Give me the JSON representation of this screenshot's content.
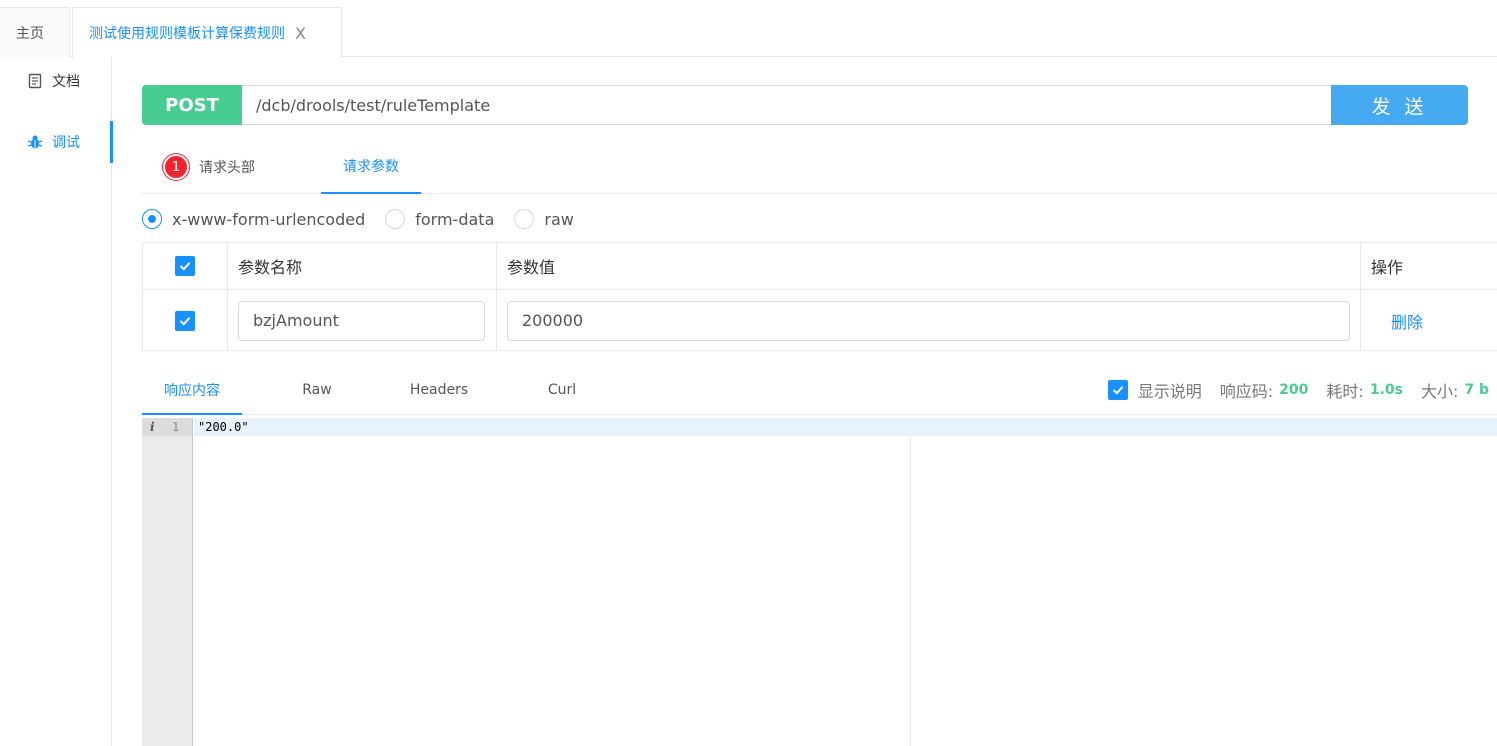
{
  "tabs": {
    "home": "主页",
    "active": "测试使用规则模板计算保费规则",
    "close": "X"
  },
  "sidenav": {
    "doc": "文档",
    "debug": "调试"
  },
  "request": {
    "method": "POST",
    "url": "/dcb/drools/test/ruleTemplate",
    "send": "发 送"
  },
  "reqtabs": {
    "headers_badge": "1",
    "headers": "请求头部",
    "params": "请求参数"
  },
  "body_types": {
    "options": [
      "x-www-form-urlencoded",
      "form-data",
      "raw"
    ],
    "selected": "x-www-form-urlencoded"
  },
  "params_table": {
    "headers": {
      "name": "参数名称",
      "value": "参数值",
      "op": "操作"
    },
    "rows": [
      {
        "checked": true,
        "name": "bzjAmount",
        "value": "200000",
        "op": "删除"
      }
    ]
  },
  "response": {
    "tabs": [
      "响应内容",
      "Raw",
      "Headers",
      "Curl"
    ],
    "show_desc": "显示说明",
    "code_label": "响应码:",
    "code": "200",
    "time_label": "耗时:",
    "time": "1.0s",
    "size_label": "大小:",
    "size": "7 b",
    "line_number": "1",
    "body": "\"200.0\""
  },
  "colors": {
    "accent": "#1890ff",
    "post": "#49cc90",
    "send": "#45aaf2",
    "badge": "#f5222d"
  }
}
